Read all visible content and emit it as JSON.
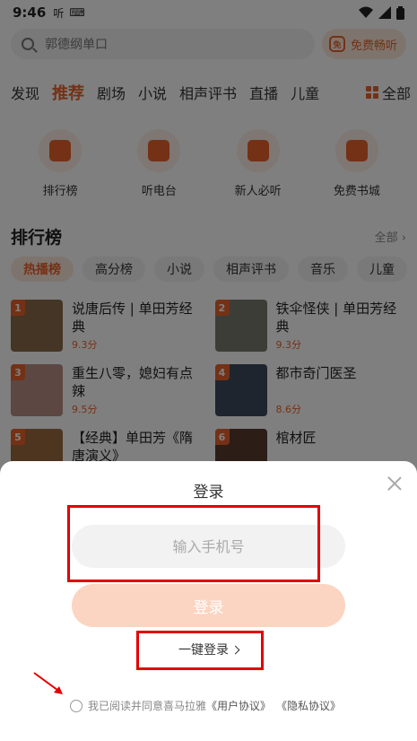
{
  "status_bar": {
    "time": "9:46",
    "app_glyph": "听",
    "keyboard_glyph": "⌨"
  },
  "search": {
    "placeholder": "郭德纲单口",
    "free_label": "免费畅听",
    "free_icon_text": "免"
  },
  "tabs": [
    "发现",
    "推荐",
    "剧场",
    "小说",
    "相声评书",
    "直播",
    "儿童"
  ],
  "tabs_all_label": "全部",
  "quick_entries": [
    "排行榜",
    "听电台",
    "新人必听",
    "免费书城"
  ],
  "ranking": {
    "title": "排行榜",
    "all_label": "全部",
    "chips": [
      "热播榜",
      "高分榜",
      "小说",
      "相声评书",
      "音乐",
      "儿童"
    ],
    "books": [
      {
        "rank": "1",
        "name": "说唐后传 | 单田芳经典",
        "score": "9.3分"
      },
      {
        "rank": "2",
        "name": "铁伞怪侠 | 单田芳经典",
        "score": "9.3分"
      },
      {
        "rank": "3",
        "name": "重生八零，媳妇有点辣",
        "score": "9.5分"
      },
      {
        "rank": "4",
        "name": "都市奇门医圣",
        "score": "8.6分"
      },
      {
        "rank": "5",
        "name": "【经典】单田芳《隋唐演义》",
        "score": ""
      },
      {
        "rank": "6",
        "name": "棺材匠",
        "score": ""
      }
    ]
  },
  "login": {
    "title": "登录",
    "phone_placeholder": "输入手机号",
    "login_button": "登录",
    "one_key_login": "一键登录",
    "agreement_prefix": "我已阅读并同意喜马拉雅",
    "user_agreement": "《用户协议》",
    "privacy_agreement": "《隐私协议》"
  },
  "colors": {
    "accent": "#e8622a",
    "annotation": "#e30000",
    "overlay": "rgba(0,0,0,0.5)"
  }
}
